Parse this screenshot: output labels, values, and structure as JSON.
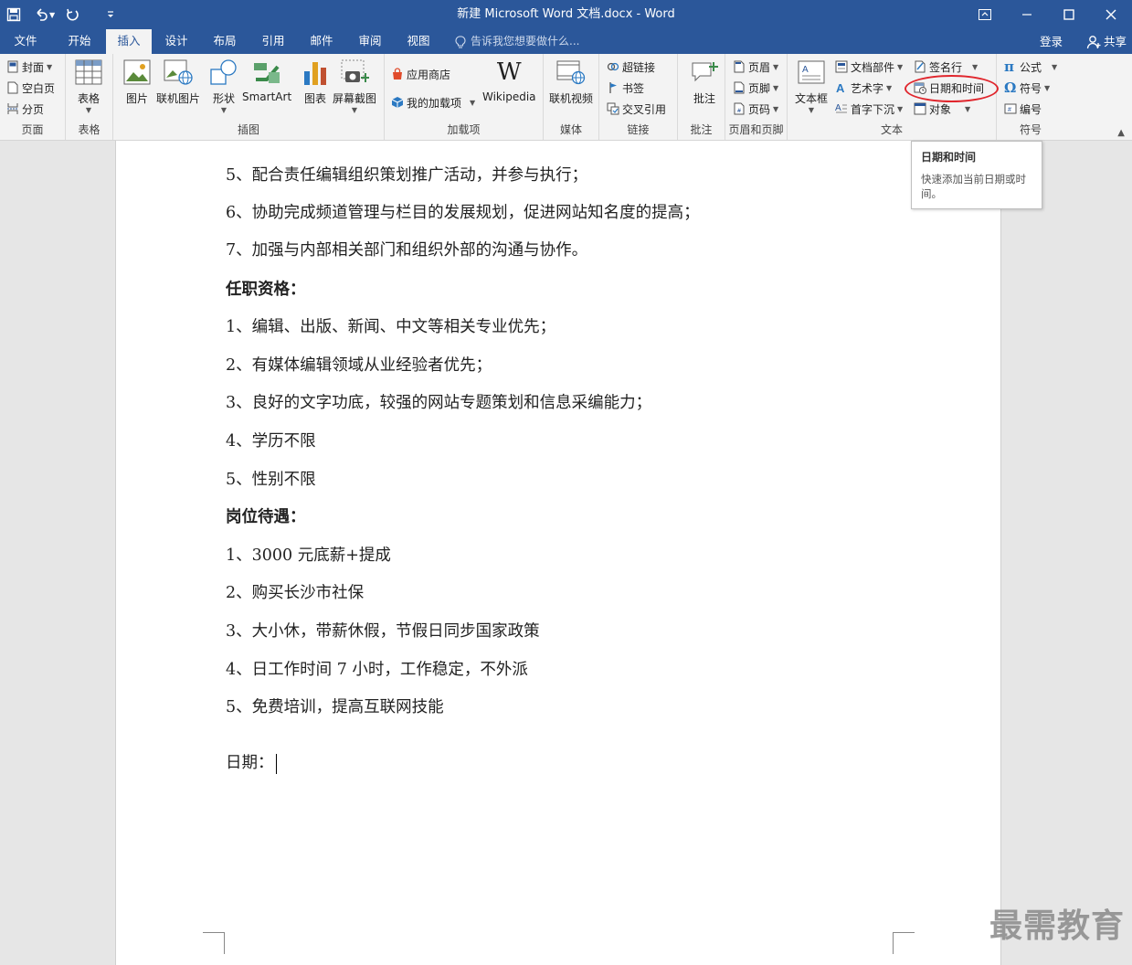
{
  "window": {
    "title": "新建 Microsoft Word 文档.docx - Word"
  },
  "tabs": [
    {
      "label": "文件"
    },
    {
      "label": "开始"
    },
    {
      "label": "插入",
      "active": true
    },
    {
      "label": "设计"
    },
    {
      "label": "布局"
    },
    {
      "label": "引用"
    },
    {
      "label": "邮件"
    },
    {
      "label": "审阅"
    },
    {
      "label": "视图"
    }
  ],
  "tellme": {
    "placeholder": "告诉我您想要做什么..."
  },
  "account": {
    "login": "登录",
    "share": "共享"
  },
  "ribbon": {
    "pages": {
      "label": "页面",
      "cover": "封面",
      "blank": "空白页",
      "break": "分页"
    },
    "tables": {
      "label": "表格",
      "table": "表格"
    },
    "illustrations": {
      "label": "插图",
      "picture": "图片",
      "online_picture": "联机图片",
      "shapes": "形状",
      "smartart": "SmartArt",
      "chart": "图表",
      "screenshot": "屏幕截图"
    },
    "addins": {
      "label": "加载项",
      "store": "应用商店",
      "my_addins": "我的加载项",
      "wikipedia": "Wikipedia"
    },
    "media": {
      "label": "媒体",
      "online_video": "联机视频"
    },
    "links": {
      "label": "链接",
      "hyperlink": "超链接",
      "bookmark": "书签",
      "crossref": "交叉引用"
    },
    "comments": {
      "label": "批注",
      "comment": "批注"
    },
    "header_footer": {
      "label": "页眉和页脚",
      "header": "页眉",
      "footer": "页脚",
      "page_number": "页码"
    },
    "text": {
      "label": "文本",
      "textbox": "文本框",
      "quick_parts": "文档部件",
      "wordart": "艺术字",
      "dropcap": "首字下沉",
      "signature": "签名行",
      "datetime": "日期和时间",
      "object": "对象"
    },
    "symbols": {
      "label": "符号",
      "equation": "公式",
      "symbol": "符号",
      "number": "编号"
    }
  },
  "tooltip": {
    "title": "日期和时间",
    "body": "快速添加当前日期或时间。"
  },
  "document": {
    "paragraphs": [
      {
        "text": "5、配合责任编辑组织策划推广活动，并参与执行；"
      },
      {
        "text": "6、协助完成频道管理与栏目的发展规划，促进网站知名度的提高；"
      },
      {
        "text": "7、加强与内部相关部门和组织外部的沟通与协作。"
      },
      {
        "text": "任职资格：",
        "bold": true
      },
      {
        "text": "1、编辑、出版、新闻、中文等相关专业优先；"
      },
      {
        "text": "2、有媒体编辑领域从业经验者优先；"
      },
      {
        "text": "3、良好的文字功底，较强的网站专题策划和信息采编能力；"
      },
      {
        "text": "4、学历不限"
      },
      {
        "text": "5、性别不限"
      },
      {
        "text": "岗位待遇：",
        "bold": true
      },
      {
        "text": "1、3000 元底薪+提成"
      },
      {
        "text": "2、购买长沙市社保"
      },
      {
        "text": "3、大小休，带薪休假，节假日同步国家政策"
      },
      {
        "text": "4、日工作时间 7 小时，工作稳定，不外派"
      },
      {
        "text": "5、免费培训，提高互联网技能"
      },
      {
        "text": "日期："
      }
    ]
  },
  "watermark": "最需教育",
  "colors": {
    "accent": "#2b579a",
    "highlight_ring": "#e0262d"
  }
}
